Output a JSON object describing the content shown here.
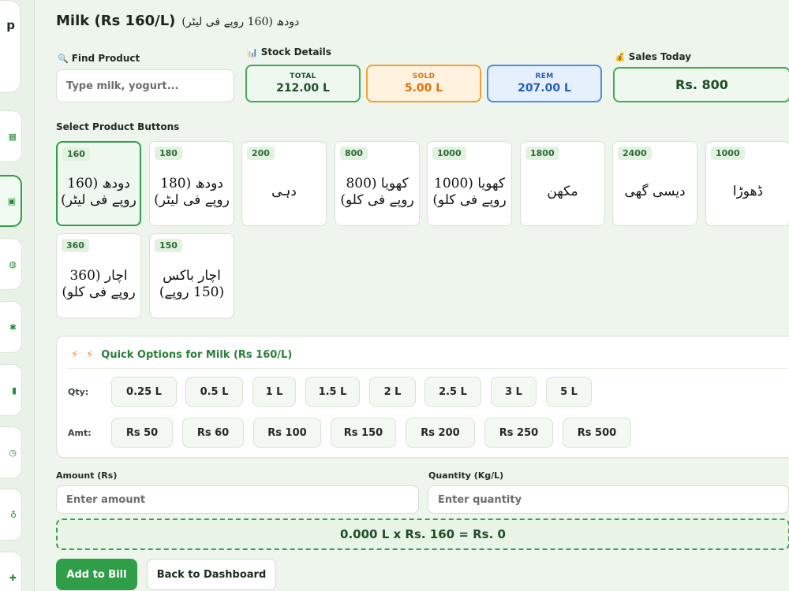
{
  "sidebar": {
    "brand_letter": "p",
    "icons": [
      "grid-icon",
      "box-icon",
      "bag-icon",
      "gear-icon",
      "chart-icon",
      "clock-icon",
      "users-icon",
      "plus-icon"
    ]
  },
  "header": {
    "title": "Milk (Rs 160/L)",
    "title_urdu": "دودھ (160 روپے فی لیٹر)"
  },
  "find_product": {
    "emoji": "🔍",
    "label": "Find Product",
    "placeholder": "Type milk, yogurt..."
  },
  "stock": {
    "emoji": "📊",
    "label": "Stock Details",
    "total_label": "TOTAL",
    "total_value": "212.00 L",
    "sold_label": "SOLD",
    "sold_value": "5.00 L",
    "rem_label": "REM",
    "rem_value": "207.00 L"
  },
  "sales": {
    "emoji": "💰",
    "label": "Sales Today",
    "value": "Rs. 800"
  },
  "products": {
    "label": "Select Product Buttons",
    "items": [
      {
        "price": "160",
        "name": "دودھ (160 روپے فی لیٹر)"
      },
      {
        "price": "180",
        "name": "دودھ (180 روپے فی لیٹر)"
      },
      {
        "price": "200",
        "name": "دہی"
      },
      {
        "price": "800",
        "name": "کھویا (800 روپے فی کلو)"
      },
      {
        "price": "1000",
        "name": "کھویا (1000 روپے فی کلو)"
      },
      {
        "price": "1800",
        "name": "مکھن"
      },
      {
        "price": "2400",
        "name": "دیسی گھی"
      },
      {
        "price": "1000",
        "name": "ڈھوڑا"
      },
      {
        "price": "360",
        "name": "اچار (360 روپے فی کلو)"
      },
      {
        "price": "150",
        "name": "اچار باکس (150 روپے)"
      }
    ]
  },
  "quick": {
    "bolt1": "⚡",
    "bolt2": "⚡",
    "title": "Quick Options for Milk (Rs 160/L)",
    "qty_label": "Qty:",
    "qty": [
      "0.25 L",
      "0.5 L",
      "1 L",
      "1.5 L",
      "2 L",
      "2.5 L",
      "3 L",
      "5 L"
    ],
    "amt_label": "Amt:",
    "amt": [
      "Rs 50",
      "Rs 60",
      "Rs 100",
      "Rs 150",
      "Rs 200",
      "Rs 250",
      "Rs 500"
    ]
  },
  "form": {
    "amount_label": "Amount (Rs)",
    "amount_placeholder": "Enter amount",
    "quantity_label": "Quantity (Kg/L)",
    "quantity_placeholder": "Enter quantity"
  },
  "calc": "0.000 L x Rs. 160 = Rs. 0",
  "actions": {
    "add": "Add to Bill",
    "back": "Back to Dashboard"
  }
}
